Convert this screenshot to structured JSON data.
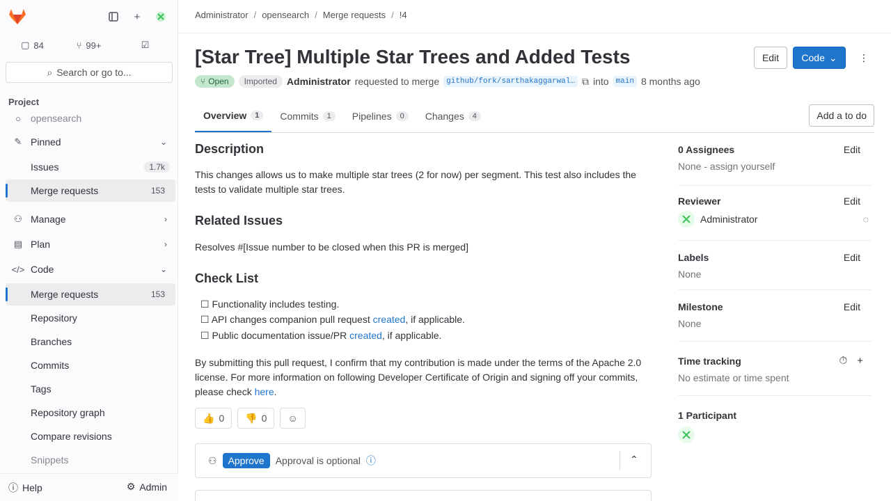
{
  "sidebar": {
    "counts": {
      "issues": "84",
      "merge_requests": "99+"
    },
    "search_label": "Search or go to...",
    "section_label": "Project",
    "project_name": "opensearch",
    "items": [
      {
        "label": "Pinned"
      },
      {
        "label": "Issues",
        "count": "1.7k"
      },
      {
        "label": "Merge requests",
        "count": "153"
      },
      {
        "label": "Manage"
      },
      {
        "label": "Plan"
      },
      {
        "label": "Code"
      },
      {
        "label": "Merge requests",
        "count": "153"
      },
      {
        "label": "Repository"
      },
      {
        "label": "Branches"
      },
      {
        "label": "Commits"
      },
      {
        "label": "Tags"
      },
      {
        "label": "Repository graph"
      },
      {
        "label": "Compare revisions"
      },
      {
        "label": "Snippets"
      }
    ],
    "help_label": "Help",
    "admin_label": "Admin"
  },
  "breadcrumb": [
    "Administrator",
    "opensearch",
    "Merge requests",
    "!4"
  ],
  "header": {
    "title": "[Star Tree] Multiple Star Trees and Added Tests",
    "edit_label": "Edit",
    "code_label": "Code",
    "status": "Open",
    "imported": "Imported",
    "author": "Administrator",
    "requested_text": "requested to merge",
    "source_branch": "github/fork/sarthakaggarwal…",
    "into_text": "into",
    "target_branch": "main",
    "time_ago": "8 months ago"
  },
  "tabs": [
    {
      "label": "Overview",
      "count": "1"
    },
    {
      "label": "Commits",
      "count": "1"
    },
    {
      "label": "Pipelines",
      "count": "0"
    },
    {
      "label": "Changes",
      "count": "4"
    }
  ],
  "todo_label": "Add a to do",
  "description": {
    "h_description": "Description",
    "p1": "This changes allows us to make multiple star trees (2 for now) per segment. This test also includes the tests to validate multiple star trees.",
    "h_related": "Related Issues",
    "p2": "Resolves #[Issue number to be closed when this PR is merged]",
    "h_check": "Check List",
    "check1": "Functionality includes testing.",
    "check2_pre": "API changes companion pull request",
    "check2_link": "created",
    "check2_post": ", if applicable.",
    "check3_pre": "Public documentation issue/PR",
    "check3_link": "created",
    "check3_post": ", if applicable.",
    "p3": "By submitting this pull request, I confirm that my contribution is made under the terms of the Apache 2.0 license. For more information on following Developer Certificate of Origin and signing off your commits, please check",
    "p3_link": "here",
    "p3_end": "."
  },
  "reactions": {
    "thumbs_up": "0",
    "thumbs_down": "0"
  },
  "approval": {
    "approve_label": "Approve",
    "optional_text": "Approval is optional"
  },
  "right_sidebar": {
    "assignees_title": "0 Assignees",
    "assignees_value": "None - assign yourself",
    "reviewer_title": "Reviewer",
    "reviewer_name": "Administrator",
    "labels_title": "Labels",
    "labels_value": "None",
    "milestone_title": "Milestone",
    "milestone_value": "None",
    "time_title": "Time tracking",
    "time_value": "No estimate or time spent",
    "participants_title": "1 Participant",
    "edit_label": "Edit"
  }
}
